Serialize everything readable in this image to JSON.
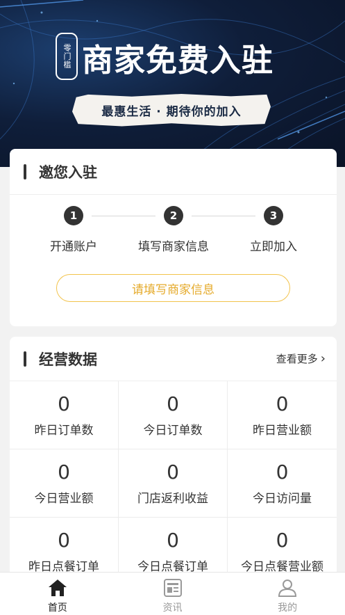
{
  "banner": {
    "badge": "零门槛",
    "title": "商家免费入驻",
    "slogan": "最惠生活 · 期待你的加入"
  },
  "invite": {
    "title": "邀您入驻",
    "steps": [
      {
        "num": "1",
        "label": "开通账户"
      },
      {
        "num": "2",
        "label": "填写商家信息"
      },
      {
        "num": "3",
        "label": "立即加入"
      }
    ],
    "cta": "请填写商家信息"
  },
  "stats": {
    "title": "经营数据",
    "more": "查看更多",
    "items": [
      {
        "value": "0",
        "label": "昨日订单数"
      },
      {
        "value": "0",
        "label": "今日订单数"
      },
      {
        "value": "0",
        "label": "昨日营业额"
      },
      {
        "value": "0",
        "label": "今日营业额"
      },
      {
        "value": "0",
        "label": "门店返利收益"
      },
      {
        "value": "0",
        "label": "今日访问量"
      },
      {
        "value": "0",
        "label": "昨日点餐订单"
      },
      {
        "value": "0",
        "label": "今日点餐订单"
      },
      {
        "value": "0",
        "label": "今日点餐营业额"
      }
    ]
  },
  "tabbar": {
    "tabs": [
      {
        "label": "首页",
        "icon": "home-icon",
        "active": true
      },
      {
        "label": "资讯",
        "icon": "news-icon",
        "active": false
      },
      {
        "label": "我的",
        "icon": "user-icon",
        "active": false
      }
    ]
  }
}
